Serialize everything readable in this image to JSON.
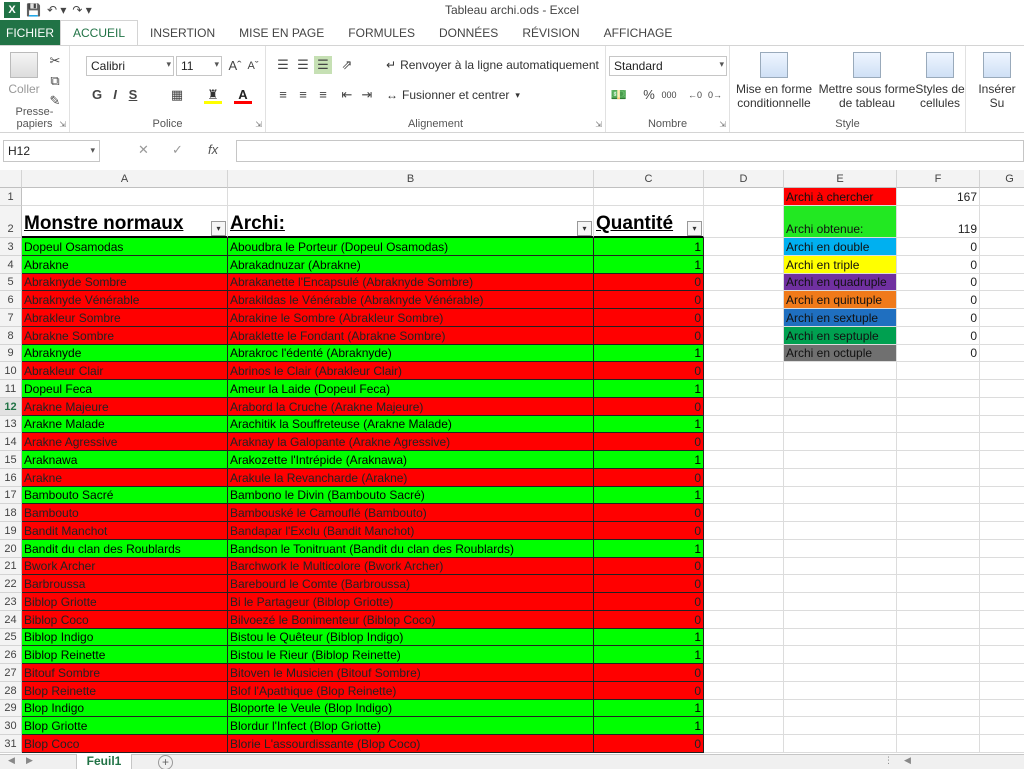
{
  "window": {
    "title": "Tableau archi.ods - Excel"
  },
  "tabs": [
    "FICHIER",
    "ACCUEIL",
    "INSERTION",
    "MISE EN PAGE",
    "FORMULES",
    "DONNÉES",
    "RÉVISION",
    "AFFICHAGE"
  ],
  "ribbon": {
    "clipboard": {
      "paste": "Coller",
      "label": "Presse-papiers"
    },
    "font": {
      "name": "Calibri",
      "size": "11",
      "bold": "G",
      "italic": "I",
      "underline": "S",
      "label": "Police"
    },
    "alignment": {
      "wrap": "Renvoyer à la ligne automatiquement",
      "merge": "Fusionner et centrer",
      "label": "Alignement"
    },
    "number": {
      "format": "Standard",
      "percent": "%",
      "thousands": "000",
      "label": "Nombre"
    },
    "style": {
      "cond_format": "Mise en forme conditionnelle",
      "as_table": "Mettre sous forme de tableau",
      "cell_styles": "Styles de cellules",
      "label": "Style"
    },
    "cells": {
      "insert": "Insérer Su"
    }
  },
  "formula_bar": {
    "name_box": "H12",
    "fx": "fx"
  },
  "columns": [
    "A",
    "B",
    "C",
    "D",
    "E",
    "F",
    "G"
  ],
  "headers": {
    "a": "Monstre normaux",
    "b": "Archi:",
    "c": "Quantité"
  },
  "summary": [
    {
      "label": "Archi à chercher",
      "value": "167",
      "color": "#ff0000"
    },
    {
      "label": "Archi obtenue:",
      "value": "119",
      "color": "#22e822"
    },
    {
      "label": "Archi en double",
      "value": "0",
      "color": "#00b0f0"
    },
    {
      "label": "Archi en triple",
      "value": "0",
      "color": "#ffff00"
    },
    {
      "label": "Archi en quadruple",
      "value": "0",
      "color": "#7030a0"
    },
    {
      "label": "Archi en quintuple",
      "value": "0",
      "color": "#f07a1a"
    },
    {
      "label": "Archi en sextuple",
      "value": "0",
      "color": "#1f6fc0"
    },
    {
      "label": "Archi en septuple",
      "value": "0",
      "color": "#00a050"
    },
    {
      "label": "Archi en octuple",
      "value": "0",
      "color": "#707070"
    }
  ],
  "rows": [
    {
      "n": "3",
      "a": "Dopeul Osamodas",
      "b": "Aboudbra le Porteur (Dopeul Osamodas)",
      "c": "1"
    },
    {
      "n": "4",
      "a": "Abrakne",
      "b": "Abrakadnuzar (Abrakne)",
      "c": "1"
    },
    {
      "n": "5",
      "a": "Abraknyde Sombre",
      "b": "Abrakanette l'Encapsulé (Abraknyde Sombre)",
      "c": "0"
    },
    {
      "n": "6",
      "a": "Abraknyde Vénérable",
      "b": "Abrakildas le Vénérable (Abraknyde Vénérable)",
      "c": "0"
    },
    {
      "n": "7",
      "a": "Abrakleur Sombre",
      "b": "Abrakine le Sombre (Abrakleur Sombre)",
      "c": "0"
    },
    {
      "n": "8",
      "a": "Abrakne Sombre",
      "b": "Abraklette le Fondant (Abrakne Sombre)",
      "c": "0"
    },
    {
      "n": "9",
      "a": "Abraknyde",
      "b": "Abrakroc l'édenté (Abraknyde)",
      "c": "1"
    },
    {
      "n": "10",
      "a": "Abrakleur Clair",
      "b": "Abrinos le Clair (Abrakleur Clair)",
      "c": "0"
    },
    {
      "n": "11",
      "a": "Dopeul Feca",
      "b": "Ameur la Laide (Dopeul Feca)",
      "c": "1"
    },
    {
      "n": "12",
      "a": "Arakne Majeure",
      "b": "Arabord la Cruche (Arakne Majeure)",
      "c": "0"
    },
    {
      "n": "13",
      "a": "Arakne Malade",
      "b": "Arachitik la Souffreteuse (Arakne Malade)",
      "c": "1"
    },
    {
      "n": "14",
      "a": "Arakne Agressive",
      "b": "Araknay la Galopante (Arakne Agressive)",
      "c": "0"
    },
    {
      "n": "15",
      "a": "Araknawa",
      "b": "Arakozette l'Intrépide (Araknawa)",
      "c": "1"
    },
    {
      "n": "16",
      "a": "Arakne",
      "b": "Arakule la Revancharde (Arakne)",
      "c": "0"
    },
    {
      "n": "17",
      "a": "Bambouto Sacré",
      "b": "Bambono le Divin (Bambouto Sacré)",
      "c": "1"
    },
    {
      "n": "18",
      "a": "Bambouto",
      "b": "Bambouské le Camouflé (Bambouto)",
      "c": "0"
    },
    {
      "n": "19",
      "a": "Bandit Manchot",
      "b": "Bandapar l'Exclu (Bandit Manchot)",
      "c": "0"
    },
    {
      "n": "20",
      "a": "Bandit du clan des Roublards",
      "b": "Bandson le Tonitruant (Bandit du clan des Roublards)",
      "c": "1"
    },
    {
      "n": "21",
      "a": "Bwork Archer",
      "b": "Barchwork le Multicolore (Bwork Archer)",
      "c": "0"
    },
    {
      "n": "22",
      "a": "Barbroussa",
      "b": "Barebourd le Comte (Barbroussa)",
      "c": "0"
    },
    {
      "n": "23",
      "a": "Biblop Griotte",
      "b": "Bi le Partageur (Biblop Griotte)",
      "c": "0"
    },
    {
      "n": "24",
      "a": "Biblop Coco",
      "b": "Bilvoezé le Bonimenteur (Biblop Coco)",
      "c": "0"
    },
    {
      "n": "25",
      "a": "Biblop Indigo",
      "b": "Bistou le Quêteur (Biblop Indigo)",
      "c": "1"
    },
    {
      "n": "26",
      "a": "Biblop Reinette",
      "b": "Bistou le Rieur (Biblop Reinette)",
      "c": "1"
    },
    {
      "n": "27",
      "a": "Bitouf Sombre",
      "b": "Bitoven le Musicien (Bitouf Sombre)",
      "c": "0"
    },
    {
      "n": "28",
      "a": "Blop Reinette",
      "b": "Blof l'Apathique (Blop Reinette)",
      "c": "0"
    },
    {
      "n": "29",
      "a": "Blop Indigo",
      "b": "Bloporte le Veule (Blop Indigo)",
      "c": "1"
    },
    {
      "n": "30",
      "a": "Blop Griotte",
      "b": "Blordur l'Infect (Blop Griotte)",
      "c": "1"
    },
    {
      "n": "31",
      "a": "Blop Coco",
      "b": "Blorie L'assourdissante (Blop Coco)",
      "c": "0"
    }
  ],
  "sheets": {
    "active": "Feuil1"
  },
  "icons": [
    "excel-logo",
    "save-icon",
    "undo-icon",
    "redo-icon",
    "paste-icon",
    "cut-icon",
    "copy-icon",
    "format-painter-icon",
    "filter-dropdown-icon",
    "add-sheet-icon"
  ]
}
